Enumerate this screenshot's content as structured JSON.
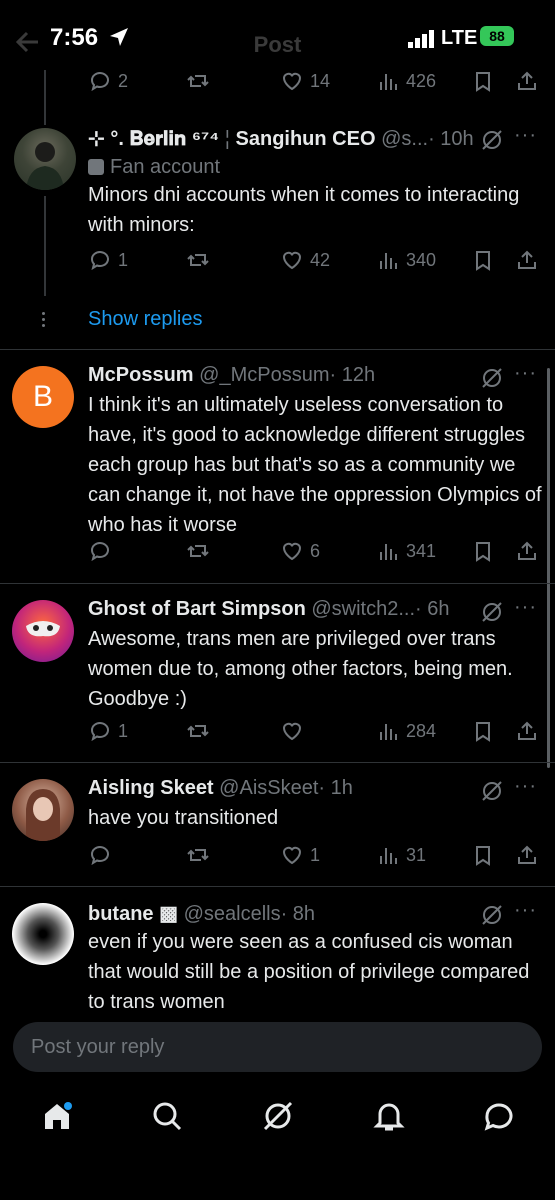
{
  "status_bar": {
    "time": "7:56",
    "network": "LTE",
    "battery": "88"
  },
  "nav": {
    "title": "Post"
  },
  "prev_tweet_actions": {
    "replies": "2",
    "retweets": "",
    "likes": "14",
    "views": "426"
  },
  "tweets": [
    {
      "display_name": "⊹ °. 𝐁𝐞𝐫𝐥𝐢𝐧 ⁶⁷⁴",
      "separator": "¦",
      "name_suffix": "Sangihun CEO",
      "handle": "@s...",
      "time": "· 10h",
      "label": "Fan account",
      "text": "Minors dni accounts when it comes to interacting with minors:",
      "replies": "1",
      "retweets": "",
      "likes": "42",
      "views": "340"
    },
    {
      "display_name": "McPossum",
      "handle": "@_McPossum",
      "time": "· 12h",
      "avatar_letter": "B",
      "text": "I think it's an ultimately useless conversation to have, it's good to acknowledge different struggles each group has but that's so as a community we can change it, not have the oppression Olympics of who has it worse",
      "replies": "",
      "retweets": "",
      "likes": "6",
      "views": "341"
    },
    {
      "display_name": "Ghost of Bart Simpson",
      "handle": "@switch2...",
      "time": "· 6h",
      "text": "Awesome, trans men are privileged over trans women due to, among other factors, being men. Goodbye :)",
      "replies": "1",
      "retweets": "",
      "likes": "",
      "views": "284"
    },
    {
      "display_name": "Aisling Skeet",
      "handle": "@AisSkeet",
      "time": "· 1h",
      "text": "have you transitioned",
      "replies": "",
      "retweets": "",
      "likes": "1",
      "views": "31"
    },
    {
      "display_name": "butane ▩",
      "handle": "@sealcells",
      "time": "· 8h",
      "text": "even if you were seen as a confused cis woman that would still be a position of privilege compared to trans women"
    }
  ],
  "show_replies": "Show replies",
  "reply_box": {
    "placeholder": "Post your reply"
  },
  "colors": {
    "accent": "#1d9bf0",
    "muted": "#71767b",
    "battery": "#34c759",
    "avatar_b": "#f4731f"
  }
}
